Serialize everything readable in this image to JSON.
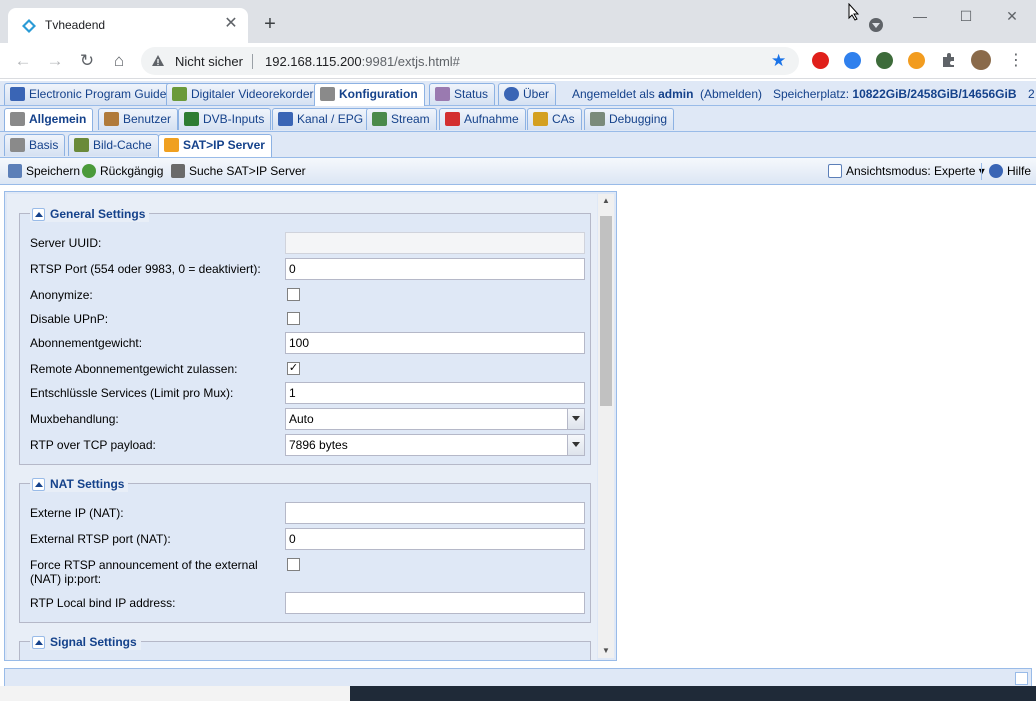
{
  "browser": {
    "tab_title": "Tvheadend",
    "tab_close": "✕",
    "new_tab": "+",
    "window_controls": {
      "minimize": "—",
      "maximize": "☐",
      "close": "✕"
    },
    "address_warning": "Nicht sicher",
    "url_host": "192.168.115.200",
    "url_rest": ":9981/extjs.html#",
    "icons": [
      "back-icon",
      "forward-icon",
      "reload-icon",
      "home-icon",
      "warning-icon",
      "star-icon",
      "puzzle-icon",
      "menu-icon"
    ]
  },
  "main_tabs": [
    {
      "label": "Electronic Program Guide",
      "icon": "epg-icon"
    },
    {
      "label": "Digitaler Videorekorder",
      "icon": "download-icon"
    },
    {
      "label": "Konfiguration",
      "icon": "wrench-icon",
      "active": true
    },
    {
      "label": "Status",
      "icon": "eye-icon"
    },
    {
      "label": "Über",
      "icon": "info-icon"
    }
  ],
  "login": {
    "prefix": "Angemeldet als",
    "user": "admin",
    "logout": "(Abmelden)",
    "storage_label": "Speicherplatz:",
    "storage_value": "10822GiB/2458GiB/14656GiB",
    "overflow": "2"
  },
  "config_tabs": [
    {
      "label": "Allgemein",
      "active": true
    },
    {
      "label": "Benutzer"
    },
    {
      "label": "DVB-Inputs"
    },
    {
      "label": "Kanal / EPG"
    },
    {
      "label": "Stream"
    },
    {
      "label": "Aufnahme"
    },
    {
      "label": "CAs"
    },
    {
      "label": "Debugging"
    }
  ],
  "sub_tabs": [
    {
      "label": "Basis"
    },
    {
      "label": "Bild-Cache"
    },
    {
      "label": "SAT>IP Server",
      "active": true
    }
  ],
  "actions": {
    "save": "Speichern",
    "undo": "Rückgängig",
    "discover": "Suche SAT>IP Server",
    "view_mode": "Ansichtsmodus: Experte",
    "help": "Hilfe"
  },
  "general_settings": {
    "title": "General Settings",
    "server_uuid_label": "Server UUID:",
    "server_uuid_value": "",
    "rtsp_port_label": "RTSP Port (554 oder 9983, 0 = deaktiviert):",
    "rtsp_port_value": "0",
    "anonymize_label": "Anonymize:",
    "anonymize_checked": false,
    "disable_upnp_label": "Disable UPnP:",
    "disable_upnp_checked": false,
    "weight_label": "Abonnementgewicht:",
    "weight_value": "100",
    "remote_weight_label": "Remote Abonnementgewicht zulassen:",
    "remote_weight_checked": true,
    "descramble_label": "Entschlüssle Services (Limit pro Mux):",
    "descramble_value": "1",
    "mux_handling_label": "Muxbehandlung:",
    "mux_handling_value": "Auto",
    "rtp_tcp_label": "RTP over TCP payload:",
    "rtp_tcp_value": "7896 bytes"
  },
  "nat_settings": {
    "title": "NAT Settings",
    "external_ip_label": "Externe IP (NAT):",
    "external_ip_value": "",
    "external_rtsp_label": "External RTSP port (NAT):",
    "external_rtsp_value": "0",
    "force_rtsp_label": "Force RTSP announcement of the external (NAT) ip:port:",
    "force_rtsp_checked": false,
    "rtp_bind_label": "RTP Local bind IP address:",
    "rtp_bind_value": ""
  },
  "signal_settings": {
    "title": "Signal Settings"
  },
  "colors": {
    "ext_accent": "#15428b",
    "ext_background": "#dfe8f6",
    "chrome_tabstrip": "#dee1e6",
    "star": "#1a73e8"
  }
}
